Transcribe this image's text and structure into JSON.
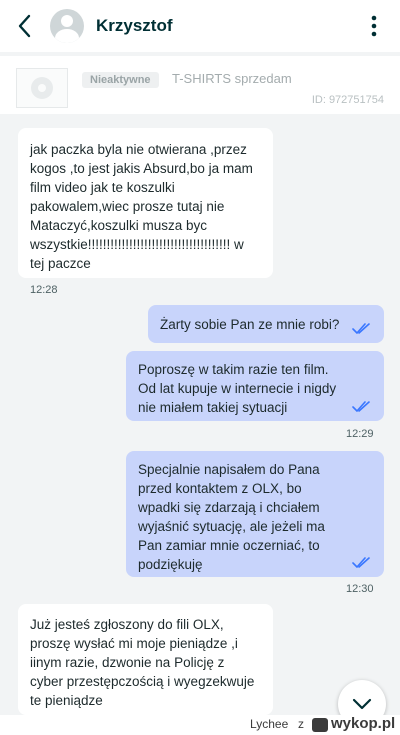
{
  "header": {
    "contact_name": "Krzysztof",
    "back_icon": "chevron-left-icon",
    "menu_icon": "more-vertical-icon"
  },
  "ad": {
    "status_badge": "Nieaktywne",
    "title": "T-SHIRTS sprzedam",
    "id_text": "ID: 972751754"
  },
  "messages": [
    {
      "direction": "in",
      "text": "jak paczka byla nie otwierana ,przez kogos ,to jest jakis Absurd,bo ja mam film video jak te koszulki pakowalem,wiec prosze tutaj nie Mataczyć,koszulki musza byc wszystkie!!!!!!!!!!!!!!!!!!!!!!!!!!!!!!!!!!!!!! w tej paczce",
      "time": "12:28"
    },
    {
      "direction": "out",
      "text": "Żarty sobie Pan ze mnie robi?",
      "read": true
    },
    {
      "direction": "out",
      "text": "Poproszę w takim razie ten film. Od lat kupuje w internecie i nigdy nie miałem takiej sytuacji",
      "read": true,
      "time": "12:29"
    },
    {
      "direction": "out",
      "text": "Specjalnie napisałem do Pana przed kontaktem z OLX, bo wpadki się zdarzają i chciałem wyjaśnić sytuację, ale jeżeli ma Pan zamiar mnie oczerniać, to podziękuję",
      "read": true,
      "time": "12:30"
    },
    {
      "direction": "in",
      "text": "Już  jesteś  zgłoszony do fili OLX, proszę  wysłać  mi moje pieniądze  ,i iinym razie, dzwonie na Policję z cyber przestępczością i wyegzekwuje te pieniądze"
    }
  ],
  "scroll_button_icon": "chevron-down-icon",
  "watermark": {
    "author": "Lychee",
    "separator": "z",
    "site": "wykop.pl"
  },
  "colors": {
    "incoming_bubble": "#ffffff",
    "outgoing_bubble": "#c8d4fb",
    "background": "#f2f4f5",
    "read_ticks": "#3a77ff"
  }
}
